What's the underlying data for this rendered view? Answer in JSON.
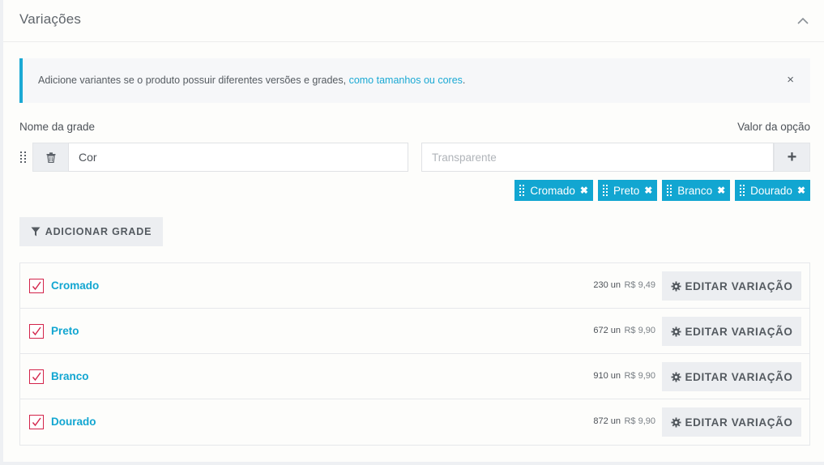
{
  "section": {
    "title": "Variações"
  },
  "info": {
    "text": "Adicione variantes se o produto possuir diferentes versões e grades, ",
    "link": "como tamanhos ou cores",
    "suffix": ".",
    "close": "×"
  },
  "grade": {
    "name_label": "Nome da grade",
    "value_label": "Valor da opção",
    "name_value": "Cor",
    "value_placeholder": "Transparente",
    "add_value": "+",
    "tags": [
      "Cromado",
      "Preto",
      "Branco",
      "Dourado"
    ],
    "tag_remove": "✖"
  },
  "add_grade_label": "ADICIONAR GRADE",
  "variations": [
    {
      "name": "Cromado",
      "qty": "230 un",
      "price": "R$ 9,49",
      "checked": true
    },
    {
      "name": "Preto",
      "qty": "672 un",
      "price": "R$ 9,90",
      "checked": true
    },
    {
      "name": "Branco",
      "qty": "910 un",
      "price": "R$ 9,90",
      "checked": true
    },
    {
      "name": "Dourado",
      "qty": "872 un",
      "price": "R$ 9,90",
      "checked": true
    }
  ],
  "edit_label": "EDITAR VARIAÇÃO",
  "colors": {
    "accent": "#12a6d1",
    "checkbox": "#d3244a",
    "button_bg": "#eceef1"
  }
}
